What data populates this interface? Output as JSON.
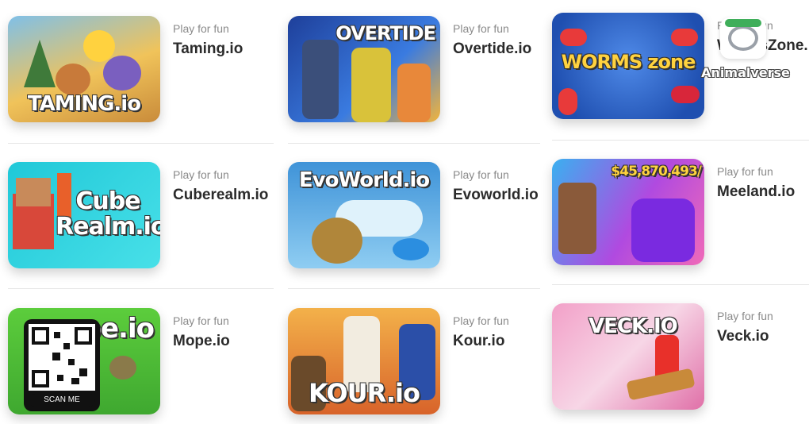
{
  "games": [
    {
      "subtitle": "Play for fun",
      "name": "Taming.io",
      "thumb_text": "TAMING.io",
      "bg": "#e8b24a"
    },
    {
      "subtitle": "Play for fun",
      "name": "Overtide.io",
      "thumb_text": "OVERTIDE",
      "bg": "#2f63c8"
    },
    {
      "subtitle": "Play for fun",
      "name": "WormsZone.io",
      "thumb_text": "WORMS zone",
      "bg": "#2a5fd0"
    },
    {
      "subtitle": "Play for fun",
      "name": "Cuberealm.io",
      "thumb_text": "Cube Realm.io",
      "bg": "#2fd3df"
    },
    {
      "subtitle": "Play for fun",
      "name": "Evoworld.io",
      "thumb_text": "EvoWorld.io",
      "bg": "#5bb0ea"
    },
    {
      "subtitle": "Play for fun",
      "name": "Meeland.io",
      "thumb_text": "$45,870,493/",
      "bg": "#9a4de0"
    },
    {
      "subtitle": "Play for fun",
      "name": "Mope.io",
      "thumb_text": "mope.io",
      "bg": "#55c23d"
    },
    {
      "subtitle": "Play for fun",
      "name": "Kour.io",
      "thumb_text": "KOUR.io",
      "bg": "#e0892a"
    },
    {
      "subtitle": "Play for fun",
      "name": "Veck.io",
      "thumb_text": "VECK.IO",
      "bg": "#e85b8a"
    }
  ],
  "qr": {
    "label": "SCAN ME"
  },
  "watermark": {
    "text": "Animalverse"
  }
}
